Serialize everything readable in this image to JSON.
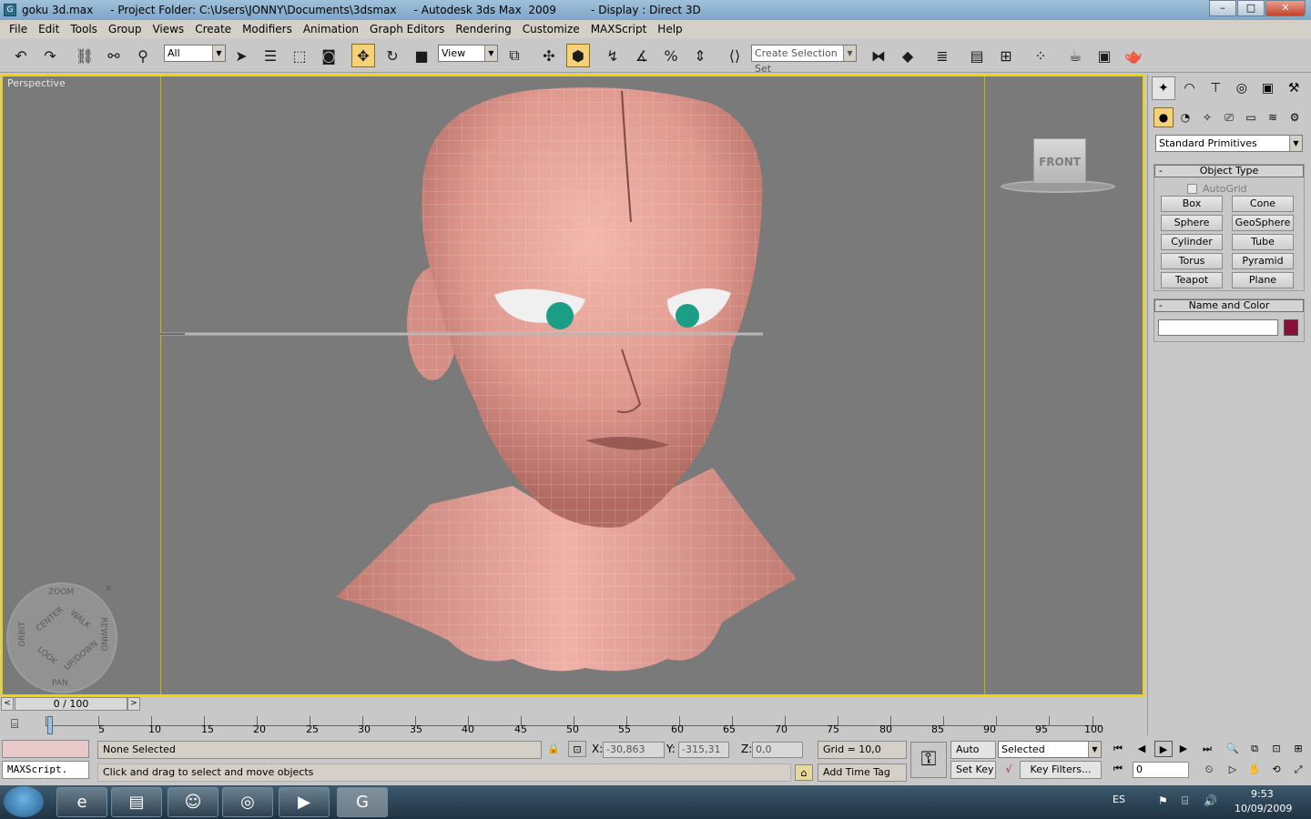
{
  "window": {
    "title": "goku 3d.max     - Project Folder: C:\\Users\\JONNY\\Documents\\3dsmax     - Autodesk 3ds Max  2009          - Display : Direct 3D",
    "icon": "3dsmax-icon",
    "buttons": {
      "minimize": "–",
      "maximize": "□",
      "close": "✕"
    }
  },
  "menu": [
    "File",
    "Edit",
    "Tools",
    "Group",
    "Views",
    "Create",
    "Modifiers",
    "Animation",
    "Graph Editors",
    "Rendering",
    "Customize",
    "MAXScript",
    "Help"
  ],
  "toolbar": {
    "selection_filter": "All",
    "ref_coord": "View",
    "selection_set_placeholder": "Create Selection Set",
    "active_tool": "select-and-move"
  },
  "viewport": {
    "label": "Perspective",
    "viewcube_face": "FRONT",
    "wheel": {
      "zoom": "ZOOM",
      "orbit": "ORBIT",
      "pan": "PAN",
      "rewind": "REWIND",
      "center": "CENTER",
      "walk": "WALK",
      "look": "LOOK",
      "updown": "UP/DOWN"
    },
    "colors": {
      "background": "#7a7a7a",
      "border_active": "#f0d400",
      "model": "#e9a39a",
      "eyes": "#1c9e86"
    }
  },
  "command_panel": {
    "category_dropdown": "Standard Primitives",
    "object_type": {
      "title": "Object Type",
      "autogrid": "AutoGrid",
      "buttons": [
        "Box",
        "Cone",
        "Sphere",
        "GeoSphere",
        "Cylinder",
        "Tube",
        "Torus",
        "Pyramid",
        "Teapot",
        "Plane"
      ]
    },
    "name_and_color": {
      "title": "Name and Color",
      "name_value": "",
      "color": "#8a0f3a"
    }
  },
  "timeline": {
    "slider_label": "0 / 100",
    "ticks": [
      "0",
      "5",
      "10",
      "15",
      "20",
      "25",
      "30",
      "35",
      "40",
      "45",
      "50",
      "55",
      "60",
      "65",
      "70",
      "75",
      "80",
      "85",
      "90",
      "95",
      "100"
    ]
  },
  "status": {
    "maxscript_label": "MAXScript.",
    "selection": "None Selected",
    "prompt": "Click and drag to select and move objects",
    "x_label": "X:",
    "x_value": "-30,863",
    "y_label": "Y:",
    "y_value": "-315,31",
    "z_label": "Z:",
    "z_value": "0,0",
    "grid": "Grid = 10,0",
    "add_time_tag": "Add Time Tag",
    "auto_key": "Auto Key",
    "set_key": "Set Key",
    "key_mode": "Selected",
    "key_filters": "Key Filters...",
    "frame": "0"
  },
  "taskbar": {
    "language": "ES",
    "time": "9:53",
    "date": "10/09/2009"
  }
}
